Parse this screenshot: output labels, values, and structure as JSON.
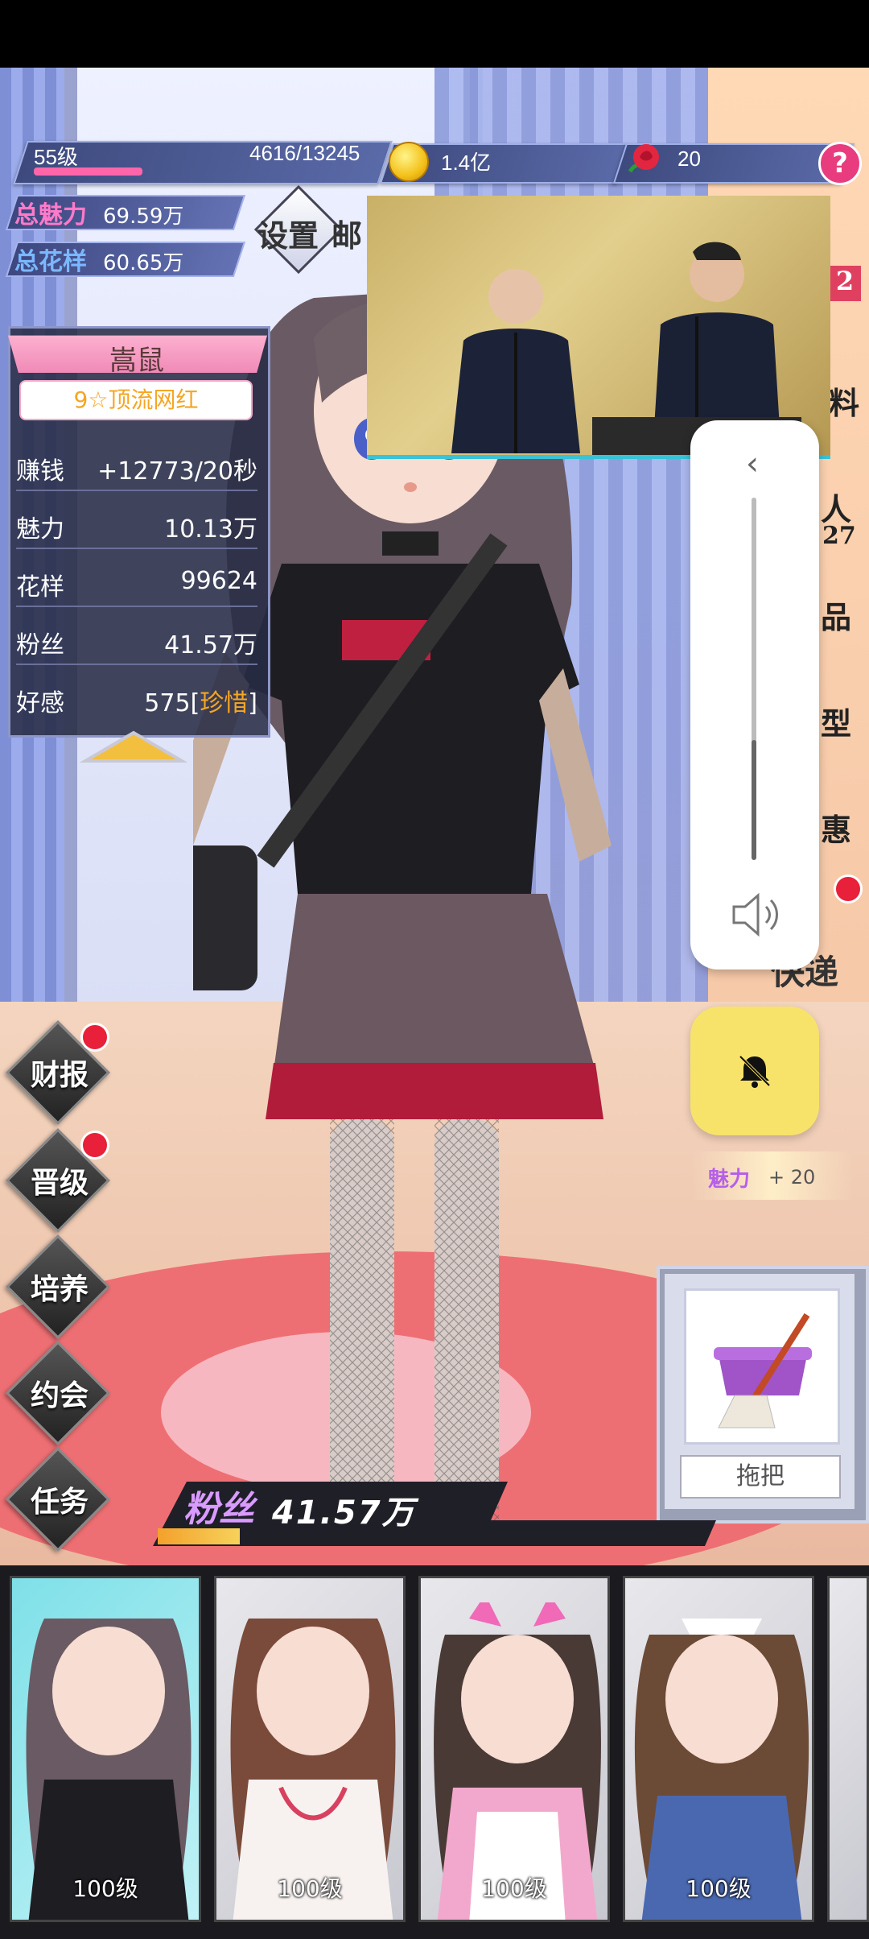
{
  "status": {
    "level": "55级",
    "exp": "4616/13245",
    "coins": "1.4亿",
    "roses": "20",
    "help": "?"
  },
  "totals": {
    "charm_label": "总魅力",
    "charm_value": "69.59万",
    "style_label": "总花样",
    "style_value": "60.65万"
  },
  "settings_label": "设置",
  "mail_label": "邮",
  "character": {
    "name": "嵩鼠",
    "rank": "9☆顶流网红",
    "stats": [
      {
        "key": "赚钱",
        "value": "+12773/20秒"
      },
      {
        "key": "魅力",
        "value": "10.13万"
      },
      {
        "key": "花样",
        "value": "99624"
      },
      {
        "key": "粉丝",
        "value": "41.57万"
      },
      {
        "key": "好感",
        "value": "575",
        "tag": "珍惜"
      }
    ]
  },
  "menu": [
    {
      "label": "财报",
      "dot": true
    },
    {
      "label": "晋级",
      "dot": true
    },
    {
      "label": "培养",
      "dot": false
    },
    {
      "label": "约会",
      "dot": false
    },
    {
      "label": "任务",
      "dot": false
    }
  ],
  "right_side": {
    "badge_number": "2",
    "partial_1": "料",
    "partial_2": "人",
    "partial_2b": "27",
    "partial_3": "品",
    "partial_4": "型",
    "partial_5": "惠",
    "courier": "快递"
  },
  "charm_popup": {
    "label": "魅力",
    "value": "+ 20"
  },
  "item": {
    "label": "拖把",
    "icon": "mop-bucket-icon"
  },
  "fans": {
    "label": "粉丝",
    "value": "41.57万",
    "progress": 0.16
  },
  "volume": {
    "level": 0.33
  },
  "cards": [
    {
      "level": "100级",
      "bg": "#7fe0e8"
    },
    {
      "level": "100级",
      "bg": "#e8e8ec"
    },
    {
      "level": "100级",
      "bg": "#e8e8ec"
    },
    {
      "level": "100级",
      "bg": "#e8e8ec"
    }
  ],
  "colors": {
    "accent_pink": "#ff7ac9",
    "accent_blue": "#7ab8ff",
    "notify_red": "#e8203a",
    "mute_yellow": "#f7e36a"
  }
}
